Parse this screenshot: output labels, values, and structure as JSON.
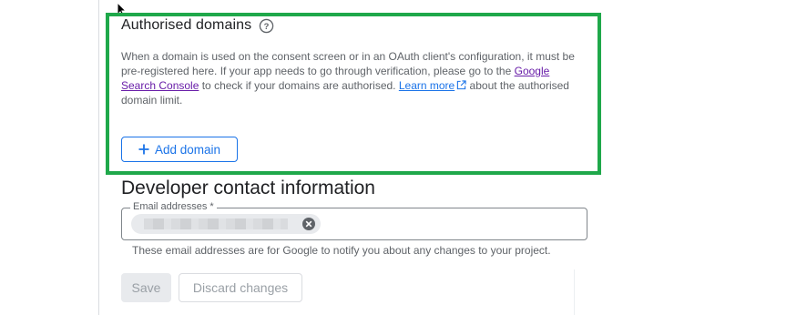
{
  "authorised_domains": {
    "title": "Authorised domains",
    "help_icon": "help-circle-icon",
    "description": {
      "part1": "When a domain is used on the consent screen or in an OAuth client's configuration, it must be pre-registered here. If your app needs to go through verification, please go to the ",
      "link1": "Google Search Console",
      "part2": " to check if your domains are authorised. ",
      "link2": "Learn more",
      "part3": " about the authorised domain limit."
    },
    "add_button_label": "Add domain",
    "add_icon": "plus-icon"
  },
  "developer_contact": {
    "title": "Developer contact information",
    "email_label": "Email addresses *",
    "chip_close_icon": "close-circle-icon",
    "helper_text": "These email addresses are for Google to notify you about any changes to your project."
  },
  "actions": {
    "save_label": "Save",
    "discard_label": "Discard changes"
  },
  "colors": {
    "highlight": "#1fa84a",
    "accent": "#1a73e8",
    "visited_link": "#681da8"
  }
}
